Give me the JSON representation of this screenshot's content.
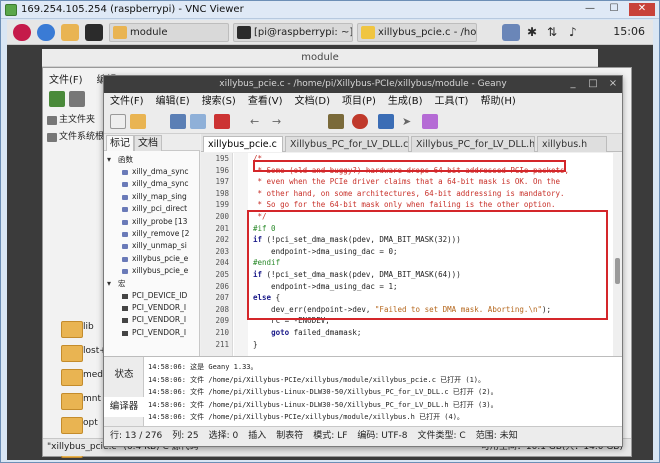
{
  "vnc": {
    "title": "169.254.105.254 (raspberrypi) - VNC Viewer",
    "min": "—",
    "max": "☐",
    "close": "✕"
  },
  "taskbar": {
    "items": [
      {
        "label": "module"
      },
      {
        "label": "[pi@raspberrypi: ~]"
      },
      {
        "label": "xillybus_pcie.c - /hom..."
      }
    ],
    "clock": "15:06",
    "icons": [
      "raspberry-icon",
      "globe-icon",
      "folder-icon",
      "terminal-icon",
      "vnc-icon",
      "bluetooth-icon",
      "wifi-icon",
      "volume-icon"
    ]
  },
  "filemanager": {
    "title": "module",
    "menu": [
      "文件(F)",
      "编辑"
    ],
    "sidebar": [
      {
        "label": "主文件夹"
      },
      {
        "label": "文件系统根"
      }
    ],
    "folders": [
      "lib",
      "lost+fo",
      "media",
      "mnt",
      "opt",
      "proc"
    ],
    "status_left": "\"xillybus_pcie.c\" (6.4 KB) C 源代码",
    "status_right": "可用空间：10.1 GB(共：14.0 GB)"
  },
  "geany": {
    "title": "xillybus_pcie.c - /home/pi/Xillybus-PCIe/xillybus/module - Geany",
    "menu": [
      "文件(F)",
      "编辑(E)",
      "搜索(S)",
      "查看(V)",
      "文档(D)",
      "项目(P)",
      "生成(B)",
      "工具(T)",
      "帮助(H)"
    ],
    "sidebar_tabs": [
      "标记",
      "文档"
    ],
    "symbols": {
      "functions_label": "函数",
      "functions": [
        "xilly_dma_sync",
        "xilly_dma_sync",
        "xilly_map_sing",
        "xilly_pci_direct",
        "xilly_probe [13",
        "xilly_remove [2",
        "xilly_unmap_si",
        "xillybus_pcie_e",
        "xillybus_pcie_e"
      ],
      "macros_label": "宏",
      "macros": [
        "PCI_DEVICE_ID",
        "PCI_VENDOR_I",
        "PCI_VENDOR_I",
        "PCI_VENDOR_I"
      ]
    },
    "tabs": [
      "xillybus_pcie.c",
      "Xillybus_PC_for_LV_DLL.c",
      "Xillybus_PC_for_LV_DLL.h",
      "xillybus.h"
    ],
    "code_lines": [
      {
        "n": "195",
        "text": "/*"
      },
      {
        "n": "196",
        "text": " * Some (old and buggy?) hardware drops 64-bit addressed PCIe packets,"
      },
      {
        "n": "197",
        "text": " * even when the PCIe driver claims that a 64-bit mask is OK. On the"
      },
      {
        "n": "198",
        "text": " * other hand, on some architectures, 64-bit addressing is mandatory."
      },
      {
        "n": "199",
        "text": " * So go for the 64-bit mask only when failing is the other option."
      },
      {
        "n": "200",
        "text": " */"
      },
      {
        "n": "201",
        "text": "#if 0"
      },
      {
        "n": "202",
        "text": "if (!pci_set_dma_mask(pdev, DMA_BIT_MASK(32)))"
      },
      {
        "n": "203",
        "text": "    endpoint->dma_using_dac = 0;"
      },
      {
        "n": "204",
        "text": "#endif"
      },
      {
        "n": "205",
        "text": "if (!pci_set_dma_mask(pdev, DMA_BIT_MASK(64)))"
      },
      {
        "n": "206",
        "text": "    endpoint->dma_using_dac = 1;"
      },
      {
        "n": "207",
        "text": "else {"
      },
      {
        "n": "208",
        "text": "    dev_err(endpoint->dev, \"Failed to set DMA mask. Aborting.\\n\");"
      },
      {
        "n": "209",
        "text": "    rc = -ENODEV;"
      },
      {
        "n": "210",
        "text": "    goto failed_dmamask;"
      },
      {
        "n": "211",
        "text": "}"
      }
    ],
    "bottom_tabs": [
      "状态",
      "编译器"
    ],
    "messages": [
      "14:58:06: 这是 Geany 1.33。",
      "14:58:06: 文件 /home/pi/Xillybus-PCIe/xillybus/module/xillybus_pcie.c 已打开 (1)。",
      "14:58:06: 文件 /home/pi/Xillybus-Linux-DLW30-50/Xillybus_PC_for_LV_DLL.c 已打开 (2)。",
      "14:58:06: 文件 /home/pi/Xillybus-Linux-DLW30-50/Xillybus_PC_for_LV_DLL.h 已打开 (3)。",
      "14:58:06: 文件 /home/pi/Xillybus-PCIe/xillybus/module/xillybus.h 已打开 (4)。"
    ],
    "status": [
      "行: 13 / 276",
      "列: 25",
      "选择: 0",
      "插入",
      "制表符",
      "模式: LF",
      "编码: UTF-8",
      "文件类型: C",
      "范围: 未知"
    ]
  }
}
